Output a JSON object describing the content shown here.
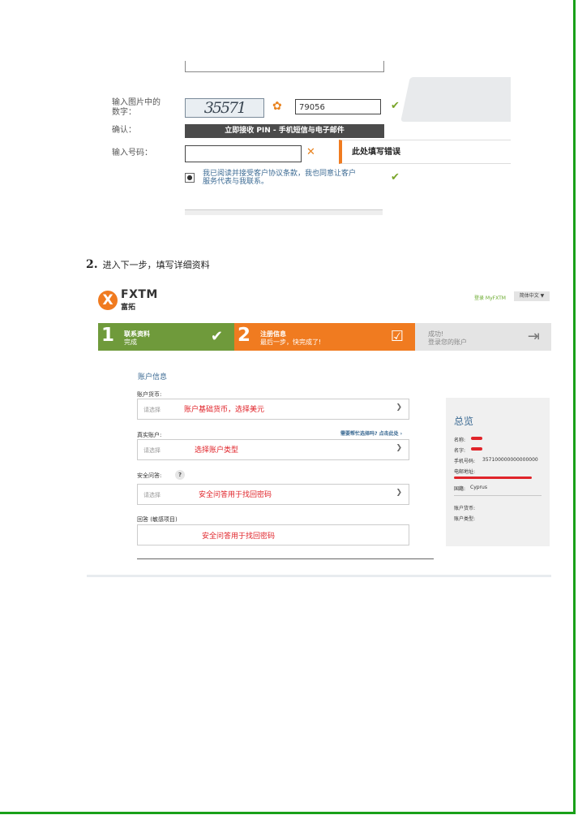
{
  "doc": {
    "step_number": "2.",
    "step_text": "进入下一步，填写详细资料"
  },
  "captcha_shot": {
    "captcha_label": "输入图片中的\n数字：",
    "captcha_image_text": "35571",
    "captcha_input_value": "79056",
    "confirm_label": "确认：",
    "confirm_button": "立即接收 PIN - 手机短信与电子邮件",
    "code_label": "输入号码：",
    "error_tip": "此处填写错误",
    "terms_text": "我已阅读并接受客户协议条款，我也同意让客户服务代表与我联系。"
  },
  "reg": {
    "logo_text": "FXTM",
    "logo_sub": "富拓",
    "login_link": "登录 MyFXTM",
    "language": "简体中文 ▼",
    "steps": [
      {
        "num": "1",
        "title": "联系资料",
        "sub": "完成",
        "icon": "✔",
        "color": "#6f9a3b"
      },
      {
        "num": "2",
        "title": "注册信息",
        "sub": "最后一步，快完成了!",
        "icon": "☑",
        "color": "#f07b20"
      },
      {
        "num": "",
        "title": "成功!",
        "sub": "登录您的账户",
        "icon": "⇥",
        "color": "#e4e4e4"
      }
    ],
    "section_title": "账户信息",
    "currency_label": "账户货币:",
    "currency_placeholder": "请选择",
    "currency_note": "账户基础货币，选择美元",
    "real_label": "真实账户:",
    "help_link": "需要帮忙选择吗? 点击此处 ›",
    "real_placeholder": "请选择",
    "real_note": "选择账户类型",
    "security_label": "安全问答:",
    "security_help": "?",
    "security_placeholder": "请选择",
    "security_note": "安全问答用于找回密码",
    "answer_label": "回答 (敏感项目)",
    "answer_note": "安全问答用于找回密码",
    "summary": {
      "title": "总览",
      "first_name": "名称:",
      "last_name": "名字:",
      "phone_label": "手机号码:",
      "phone_value": "357100000000000000",
      "email_label": "电邮地址:",
      "country_label": "国籍:",
      "country_value": "Cyprus",
      "account_currency": "账户货币:",
      "account_type": "账户类型:"
    }
  }
}
